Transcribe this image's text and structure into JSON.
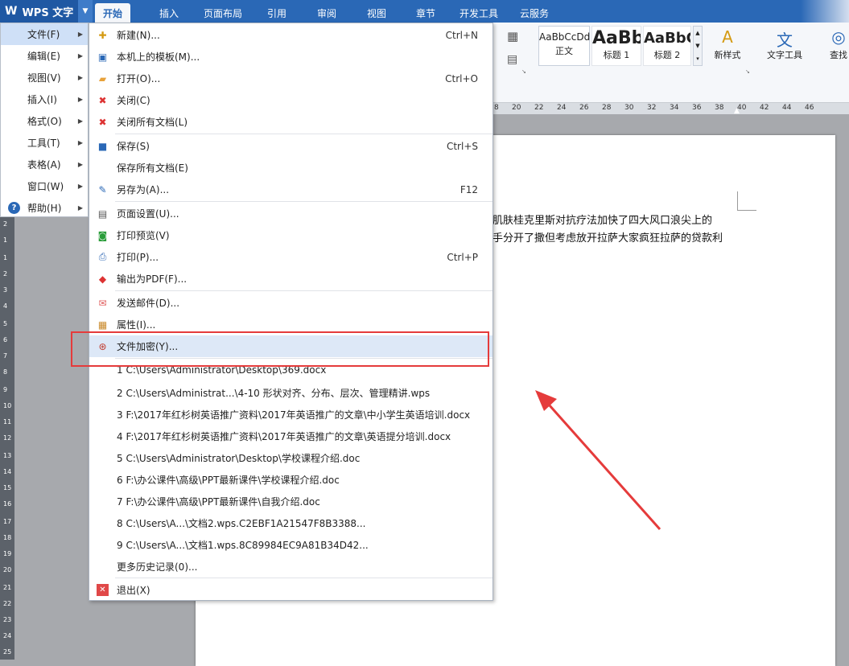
{
  "app": {
    "logo_label": "WPS 文字"
  },
  "tabs": [
    "开始",
    "插入",
    "页面布局",
    "引用",
    "审阅",
    "视图",
    "章节",
    "开发工具",
    "云服务"
  ],
  "ribbon": {
    "styles": [
      {
        "sample": "AaBbCcDd",
        "caption": "正文"
      },
      {
        "sample": "AaBb",
        "caption": "标题 1"
      },
      {
        "sample": "AaBbC",
        "caption": "标题 2"
      }
    ],
    "new_style_label": "新样式",
    "text_tools_label": "文字工具",
    "find_label": "查找"
  },
  "ruler_ticks": [
    "8",
    "20",
    "22",
    "24",
    "26",
    "28",
    "30",
    "32",
    "34",
    "36",
    "38",
    "40",
    "42",
    "44",
    "46"
  ],
  "vruler_ticks": [
    "2",
    "1",
    "1",
    "2",
    "3",
    "4",
    "5",
    "6",
    "7",
    "8",
    "9",
    "10",
    "11",
    "12",
    "13",
    "14",
    "15",
    "16",
    "17",
    "18",
    "19",
    "20",
    "21",
    "22",
    "23",
    "24",
    "25"
  ],
  "document": {
    "line1": "肌肤桂克里斯对抗疗法加快了四大风口浪尖上的",
    "line2": "手分开了撒但考虑放开拉萨大家疯狂拉萨的贷款利"
  },
  "main_menu": [
    {
      "label": "文件(F)"
    },
    {
      "label": "编辑(E)"
    },
    {
      "label": "视图(V)"
    },
    {
      "label": "插入(I)"
    },
    {
      "label": "格式(O)"
    },
    {
      "label": "工具(T)"
    },
    {
      "label": "表格(A)"
    },
    {
      "label": "窗口(W)"
    },
    {
      "label": "帮助(H)"
    }
  ],
  "file_menu": {
    "items": [
      {
        "label": "新建(N)...",
        "shortcut": "Ctrl+N"
      },
      {
        "label": "本机上的模板(M)...",
        "shortcut": ""
      },
      {
        "label": "打开(O)...",
        "shortcut": "Ctrl+O"
      },
      {
        "label": "关闭(C)",
        "shortcut": ""
      },
      {
        "label": "关闭所有文档(L)",
        "shortcut": ""
      },
      {
        "label": "保存(S)",
        "shortcut": "Ctrl+S"
      },
      {
        "label": "保存所有文档(E)",
        "shortcut": ""
      },
      {
        "label": "另存为(A)...",
        "shortcut": "F12"
      },
      {
        "label": "页面设置(U)...",
        "shortcut": ""
      },
      {
        "label": "打印预览(V)",
        "shortcut": ""
      },
      {
        "label": "打印(P)...",
        "shortcut": "Ctrl+P"
      },
      {
        "label": "输出为PDF(F)...",
        "shortcut": ""
      },
      {
        "label": "发送邮件(D)...",
        "shortcut": ""
      },
      {
        "label": "属性(I)...",
        "shortcut": ""
      },
      {
        "label": "文件加密(Y)...",
        "shortcut": ""
      }
    ],
    "recent": [
      "1 C:\\Users\\Administrator\\Desktop\\369.docx",
      "2 C:\\Users\\Administrat...\\4-10 形状对齐、分布、层次、管理精讲.wps",
      "3 F:\\2017年红杉树英语推广资料\\2017年英语推广的文章\\中小学生英语培训.docx",
      "4 F:\\2017年红杉树英语推广资料\\2017年英语推广的文章\\英语提分培训.docx",
      "5 C:\\Users\\Administrator\\Desktop\\学校课程介绍.doc",
      "6 F:\\办公课件\\高级\\PPT最新课件\\学校课程介绍.doc",
      "7 F:\\办公课件\\高级\\PPT最新课件\\自我介绍.doc",
      "8 C:\\Users\\A...\\文档2.wps.C2EBF1A21547F8B3388...",
      "9 C:\\Users\\A...\\文档1.wps.8C89984EC9A81B34D42..."
    ],
    "more_history": "更多历史记录(0)...",
    "exit": "退出(X)"
  },
  "colors": {
    "tabbar": "#2a68b6",
    "highlight_box": "#e53b3b",
    "menu_hover": "#dde8f7"
  }
}
